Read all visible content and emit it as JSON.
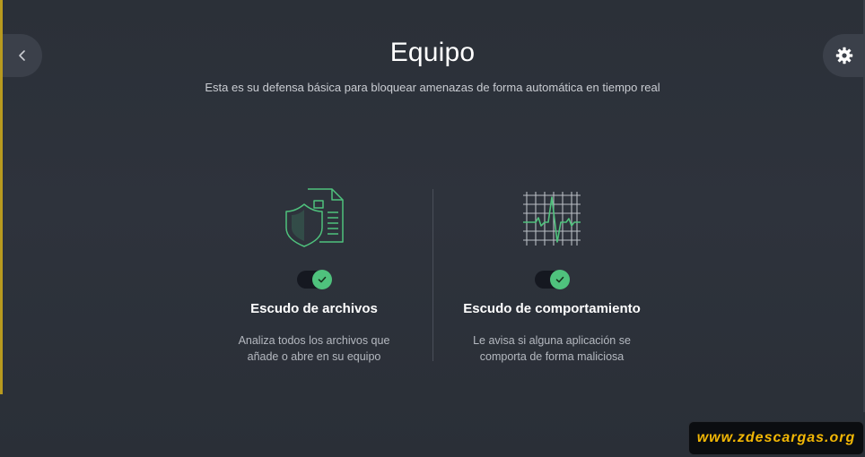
{
  "header": {
    "title": "Equipo",
    "subtitle": "Esta es su defensa básica para bloquear amenazas de forma automática en tiempo real"
  },
  "icons": {
    "back": "chevron-left-icon",
    "settings": "gear-icon",
    "file_shield": "file-shield-icon",
    "behavior_monitor": "heartbeat-grid-icon"
  },
  "cards": [
    {
      "title": "Escudo de archivos",
      "description": "Analiza todos los archivos que añade o abre en su equipo",
      "toggle_on": true
    },
    {
      "title": "Escudo de comportamiento",
      "description": "Le avisa si alguna aplicación se comporta de forma maliciosa",
      "toggle_on": true
    }
  ],
  "watermark": "www.zdescargas.org",
  "colors": {
    "background": "#2e333c",
    "accent_green": "#4fc27d",
    "watermark_text": "#f2b705"
  }
}
